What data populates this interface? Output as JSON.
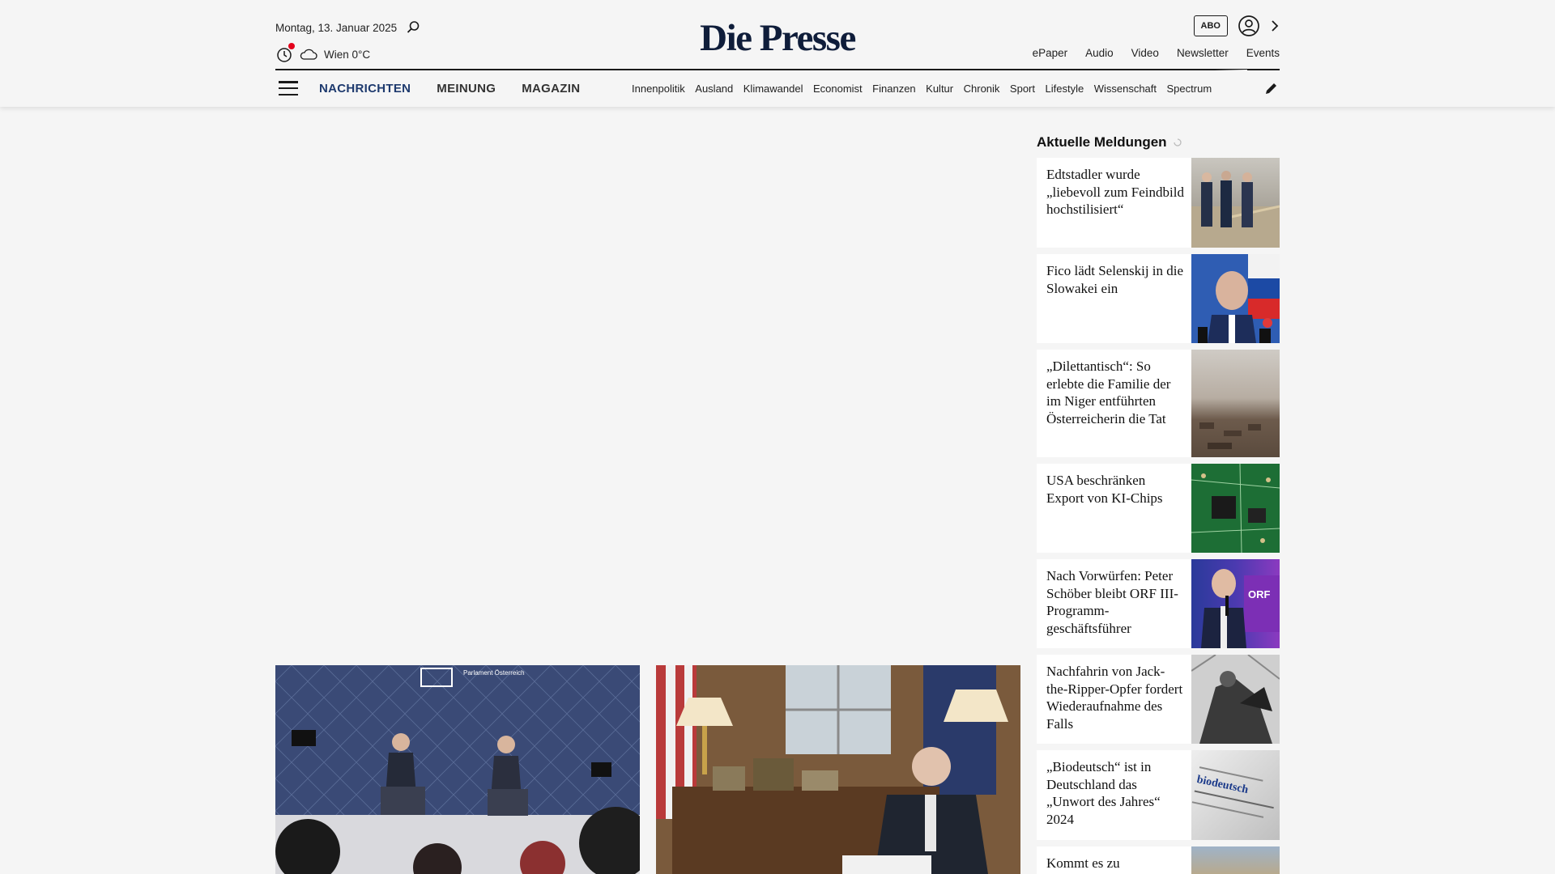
{
  "header": {
    "date": "Montag, 13. Januar 2025",
    "weather": "Wien 0°C",
    "logo": "Die Presse",
    "abo_label": "ABO",
    "service_links": [
      "ePaper",
      "Audio",
      "Video",
      "Newsletter",
      "Events"
    ]
  },
  "nav": {
    "main": [
      "NACHRICHTEN",
      "MEINUNG",
      "MAGAZIN"
    ],
    "sub": [
      "Innenpolitik",
      "Ausland",
      "Klimawandel",
      "Economist",
      "Finanzen",
      "Kultur",
      "Chronik",
      "Sport",
      "Lifestyle",
      "Wissenschaft",
      "Spectrum"
    ]
  },
  "sidebar": {
    "title": "Aktuelle Meldungen",
    "items": [
      {
        "title": "Edtstadler wurde „liebevoll zum Feindbild hochstilisiert“"
      },
      {
        "title": "Fico lädt Selenskij in die Slowakei ein"
      },
      {
        "title": "„Dilettantisch“: So erlebte die Familie der im Niger entführten Öster­reicherin die Tat"
      },
      {
        "title": "USA beschränken Export von KI-Chips"
      },
      {
        "title": "Nach Vorwürfen: Peter Schöber bleibt ORF III-Programm­geschäftsführer"
      },
      {
        "title": "Nachfahrin von Jack-the-Ripper-Opfer fordert Wiederauf­nahme des Falls"
      },
      {
        "title": "„Biodeutsch“ ist in Deutschland das „Unwort des Jahres“ 2024"
      },
      {
        "title": "Kommt es zu"
      }
    ]
  },
  "teasers": {
    "left_caption": "Parlament Österreich",
    "thumb_orf": "ORF",
    "thumb_biodeutsch": "biodeutsch"
  },
  "colors": {
    "brand": "#0f1d3a",
    "nav_active": "#1e3a6e",
    "alert": "#e3001b"
  }
}
